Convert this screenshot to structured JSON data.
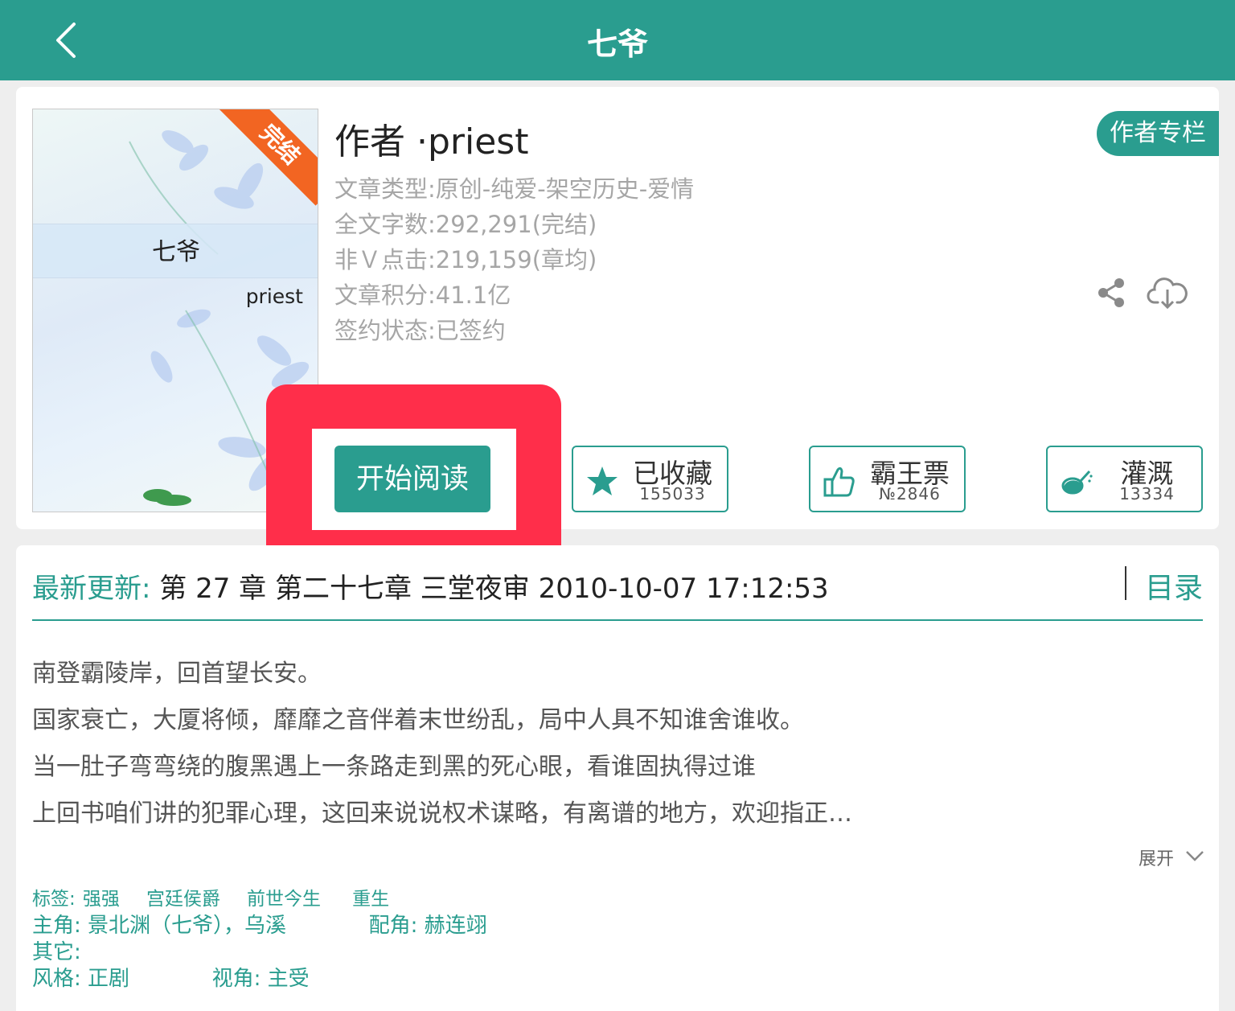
{
  "header": {
    "title": "七爷"
  },
  "book": {
    "cover_title": "七爷",
    "cover_author": "priest",
    "cover_ribbon": "完结",
    "author_line": "作者 ·priest",
    "author_column_label": "作者专栏",
    "meta": [
      "文章类型:原创-纯爱-架空历史-爱情",
      "全文字数:292,291(完结)",
      "非Ｖ点击:219,159(章均)",
      "文章积分:41.1亿",
      "签约状态:已签约"
    ]
  },
  "actions": {
    "start_reading": "开始阅读",
    "favorite": {
      "label": "已收藏",
      "value": "155033",
      "icon": "star-icon"
    },
    "vote": {
      "label": "霸王票",
      "value": "№2846",
      "icon": "thumbs-up-icon"
    },
    "water": {
      "label": "灌溉",
      "value": "13334",
      "icon": "watering-can-icon"
    }
  },
  "latest": {
    "label": "最新更新:",
    "text": "第 27 章 第二十七章 三堂夜审 2010-10-07 17:12:53",
    "toc_label": "目录"
  },
  "intro": [
    "南登霸陵岸，回首望长安。",
    "国家衰亡，大厦将倾，靡靡之音伴着末世纷乱，局中人具不知谁舍谁收。",
    "当一肚子弯弯绕的腹黑遇上一条路走到黑的死心眼，看谁固执得过谁",
    "上回书咱们讲的犯罪心理，这回来说说权术谋略，有离谱的地方，欢迎指正…"
  ],
  "expand_label": "展开",
  "tags": {
    "label": "标签:",
    "items": [
      "强强",
      "宫廷侯爵",
      "前世今生",
      "重生"
    ]
  },
  "roles": {
    "main_label": "主角:",
    "main_value": "景北渊（七爷），乌溪",
    "support_label": "配角:",
    "support_value": "赫连翊"
  },
  "other": {
    "label": "其它:",
    "value": ""
  },
  "style": {
    "label": "风格:",
    "value": "正剧",
    "pov_label": "视角:",
    "pov_value": "主受"
  },
  "colors": {
    "accent": "#2a9d8f",
    "highlight": "#ff2e4a",
    "ribbon": "#f26522"
  }
}
